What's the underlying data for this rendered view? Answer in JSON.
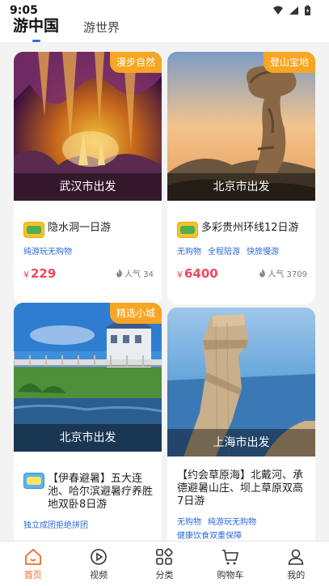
{
  "status_bar": {
    "time": "9:05"
  },
  "header": {
    "tabs": [
      "游中国",
      "游世界"
    ]
  },
  "colors": {
    "accent": "#2b6ff5",
    "tag": "#f6a623",
    "price": "#f0475d",
    "nav_active": "#f06a2a"
  },
  "cards": [
    {
      "tag": "漫步自然",
      "depart": "武汉市出发",
      "title": "隐水洞一日游",
      "features": [
        "纯游玩无购物"
      ],
      "price": "229",
      "popularity": "人气 34"
    },
    {
      "tag": "登山宝地",
      "depart": "北京市出发",
      "title": "多彩贵州环线12日游",
      "features": [
        "无购物",
        "全程陪游",
        "快旅慢游"
      ],
      "price": "6400",
      "popularity": "人气 3709"
    },
    {
      "tag": "精选小城",
      "depart": "北京市出发",
      "title": "【伊春避暑】五大连池、哈尔滨避暑疗养胜地双卧8日游",
      "features": [
        "独立成团拒绝拼团"
      ]
    },
    {
      "tag": "",
      "depart": "上海市出发",
      "title": "【约会草原海】北戴河、承德避暑山庄、坝上草原双高7日游",
      "features": [
        "无购物",
        "纯游玩无购物",
        "健康饮食双重保障"
      ]
    }
  ],
  "price_symbol": "¥",
  "nav": {
    "items": [
      {
        "label": "首页",
        "icon": "home-icon"
      },
      {
        "label": "视频",
        "icon": "video-icon"
      },
      {
        "label": "分类",
        "icon": "category-icon"
      },
      {
        "label": "购物车",
        "icon": "cart-icon"
      },
      {
        "label": "我的",
        "icon": "profile-icon"
      }
    ]
  }
}
